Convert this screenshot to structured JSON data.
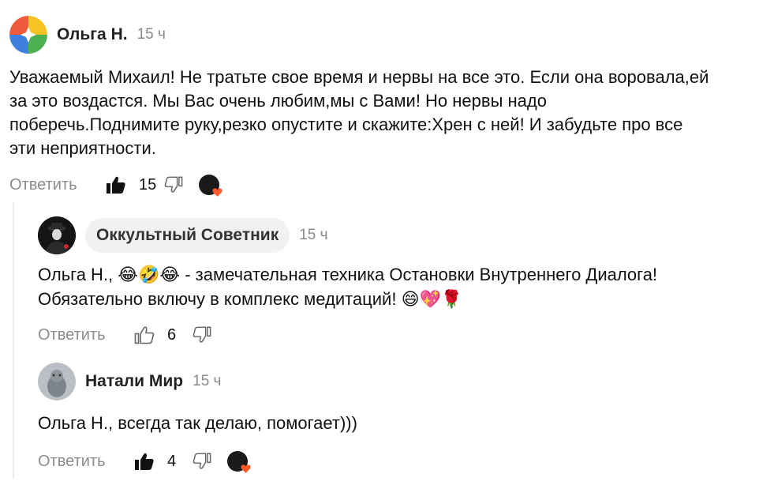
{
  "comments": [
    {
      "author": "Ольга Н.",
      "time": "15 ч",
      "text": "Уважаемый Михаил! Не тратьте свое время и нервы на все это. Если она воровала,ей\nза это воздастся. Мы Вас очень любим,мы с Вами! Но нервы надо\nпоберечь.Поднимите руку,резко опустите и скажите:Хрен с ней! И забудьте про все\nэти неприятности.",
      "reply_label": "Ответить",
      "likes": "15"
    }
  ],
  "replies": [
    {
      "author": "Оккультный Советник",
      "time": "15 ч",
      "text_line1_prefix": "Ольга Н.,",
      "text_line1_emoji": "😂🤣😂",
      "text_line1_suffix": " - замечательная техника Остановки Внутреннего Диалога!",
      "text_line2": "Обязательно включу в комплекс медитаций!",
      "text_line2_emoji": "😄💖🌹",
      "reply_label": "Ответить",
      "likes": "6"
    },
    {
      "author": "Натали Мир",
      "time": "15 ч",
      "text": "Ольга Н., всегда так делаю, помогает)))",
      "reply_label": "Ответить",
      "likes": "4"
    }
  ],
  "colors": {
    "accent_heart": "#ff5a2c",
    "muted": "#8c8c8c"
  }
}
